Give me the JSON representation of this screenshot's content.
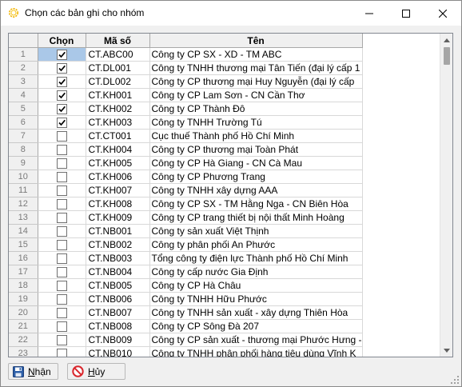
{
  "window": {
    "title": "Chọn các bản ghi cho nhóm"
  },
  "grid": {
    "headers": {
      "chk": "Chọn",
      "code": "Mã số",
      "name": "Tên"
    },
    "rows": [
      {
        "n": "1",
        "checked": true,
        "code": "CT.ABC00",
        "name": "Công ty CP SX - XD - TM ABC"
      },
      {
        "n": "2",
        "checked": true,
        "code": "CT.DL001",
        "name": "Công ty TNHH thương mại Tân Tiến (đại lý cấp 1"
      },
      {
        "n": "3",
        "checked": true,
        "code": "CT.DL002",
        "name": "Công ty CP thương mại Huy Nguyễn (đại lý cấp"
      },
      {
        "n": "4",
        "checked": true,
        "code": "CT.KH001",
        "name": "Công ty CP  Lam Sơn - CN Cần Thơ"
      },
      {
        "n": "5",
        "checked": true,
        "code": "CT.KH002",
        "name": "Công ty CP Thành Đô"
      },
      {
        "n": "6",
        "checked": true,
        "code": "CT.KH003",
        "name": "Công ty TNHH Trường Tú"
      },
      {
        "n": "7",
        "checked": false,
        "code": "CT.CT001",
        "name": "Cục thuế Thành phố Hồ Chí Minh"
      },
      {
        "n": "8",
        "checked": false,
        "code": "CT.KH004",
        "name": "Công ty CP thương mại Toàn Phát"
      },
      {
        "n": "9",
        "checked": false,
        "code": "CT.KH005",
        "name": "Công ty CP Hà Giang - CN Cà Mau"
      },
      {
        "n": "10",
        "checked": false,
        "code": "CT.KH006",
        "name": "Công ty CP Phương Trang"
      },
      {
        "n": "11",
        "checked": false,
        "code": "CT.KH007",
        "name": "Công ty TNHH xây dựng AAA"
      },
      {
        "n": "12",
        "checked": false,
        "code": "CT.KH008",
        "name": "Công ty CP SX - TM Hằng Nga - CN Biên Hòa"
      },
      {
        "n": "13",
        "checked": false,
        "code": "CT.KH009",
        "name": "Công ty CP trang thiết bị nội thất Minh Hoàng"
      },
      {
        "n": "14",
        "checked": false,
        "code": "CT.NB001",
        "name": "Công ty sản xuất Việt Thịnh"
      },
      {
        "n": "15",
        "checked": false,
        "code": "CT.NB002",
        "name": "Công ty phân phối An Phước"
      },
      {
        "n": "16",
        "checked": false,
        "code": "CT.NB003",
        "name": "Tổng công ty điện lực Thành phố Hồ Chí Minh"
      },
      {
        "n": "17",
        "checked": false,
        "code": "CT.NB004",
        "name": "Công ty cấp nước Gia Định"
      },
      {
        "n": "18",
        "checked": false,
        "code": "CT.NB005",
        "name": "Công ty CP Hà Châu"
      },
      {
        "n": "19",
        "checked": false,
        "code": "CT.NB006",
        "name": "Công ty TNHH Hữu Phước"
      },
      {
        "n": "20",
        "checked": false,
        "code": "CT.NB007",
        "name": "Công ty TNHH sản xuất - xây dựng Thiên Hòa"
      },
      {
        "n": "21",
        "checked": false,
        "code": "CT.NB008",
        "name": "Công ty CP Sông Đà 207"
      },
      {
        "n": "22",
        "checked": false,
        "code": "CT.NB009",
        "name": "Công ty CP sản xuất - thương mại Phước Hưng -"
      },
      {
        "n": "23",
        "checked": false,
        "code": "CT.NB010",
        "name": "Công ty TNHH phân phối hàng tiêu dùng Vĩnh K"
      }
    ]
  },
  "buttons": {
    "ok": {
      "accel": "N",
      "rest": "hận"
    },
    "cancel": {
      "accel": "H",
      "rest": "ủy"
    }
  },
  "icons": {
    "app": "sun-icon",
    "minimize": "minimize-icon",
    "maximize": "maximize-icon",
    "close": "close-icon",
    "ok": "floppy-disk-icon",
    "cancel": "no-entry-icon"
  },
  "colors": {
    "focus_cell": "#aac8e8",
    "cancel_red": "#d9262c",
    "save_blue": "#2d5fa8"
  }
}
